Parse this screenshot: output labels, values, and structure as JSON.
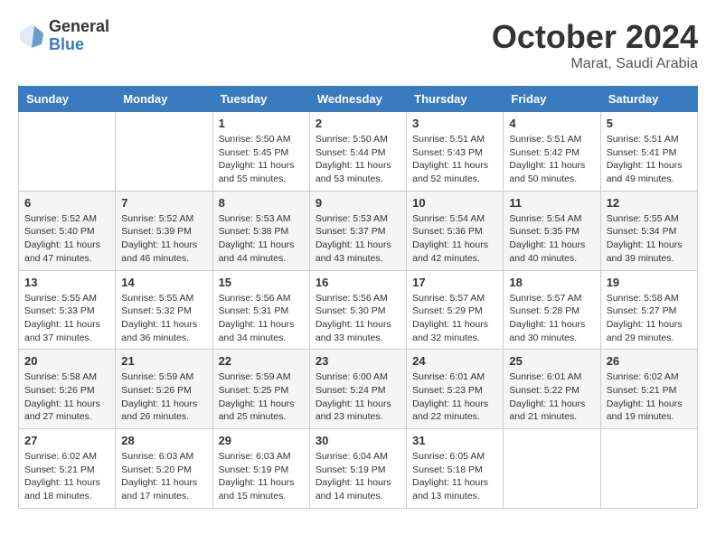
{
  "header": {
    "logo_general": "General",
    "logo_blue": "Blue",
    "month_title": "October 2024",
    "location": "Marat, Saudi Arabia"
  },
  "weekdays": [
    "Sunday",
    "Monday",
    "Tuesday",
    "Wednesday",
    "Thursday",
    "Friday",
    "Saturday"
  ],
  "weeks": [
    [
      {
        "day": "",
        "info": ""
      },
      {
        "day": "",
        "info": ""
      },
      {
        "day": "1",
        "info": "Sunrise: 5:50 AM\nSunset: 5:45 PM\nDaylight: 11 hours and 55 minutes."
      },
      {
        "day": "2",
        "info": "Sunrise: 5:50 AM\nSunset: 5:44 PM\nDaylight: 11 hours and 53 minutes."
      },
      {
        "day": "3",
        "info": "Sunrise: 5:51 AM\nSunset: 5:43 PM\nDaylight: 11 hours and 52 minutes."
      },
      {
        "day": "4",
        "info": "Sunrise: 5:51 AM\nSunset: 5:42 PM\nDaylight: 11 hours and 50 minutes."
      },
      {
        "day": "5",
        "info": "Sunrise: 5:51 AM\nSunset: 5:41 PM\nDaylight: 11 hours and 49 minutes."
      }
    ],
    [
      {
        "day": "6",
        "info": "Sunrise: 5:52 AM\nSunset: 5:40 PM\nDaylight: 11 hours and 47 minutes."
      },
      {
        "day": "7",
        "info": "Sunrise: 5:52 AM\nSunset: 5:39 PM\nDaylight: 11 hours and 46 minutes."
      },
      {
        "day": "8",
        "info": "Sunrise: 5:53 AM\nSunset: 5:38 PM\nDaylight: 11 hours and 44 minutes."
      },
      {
        "day": "9",
        "info": "Sunrise: 5:53 AM\nSunset: 5:37 PM\nDaylight: 11 hours and 43 minutes."
      },
      {
        "day": "10",
        "info": "Sunrise: 5:54 AM\nSunset: 5:36 PM\nDaylight: 11 hours and 42 minutes."
      },
      {
        "day": "11",
        "info": "Sunrise: 5:54 AM\nSunset: 5:35 PM\nDaylight: 11 hours and 40 minutes."
      },
      {
        "day": "12",
        "info": "Sunrise: 5:55 AM\nSunset: 5:34 PM\nDaylight: 11 hours and 39 minutes."
      }
    ],
    [
      {
        "day": "13",
        "info": "Sunrise: 5:55 AM\nSunset: 5:33 PM\nDaylight: 11 hours and 37 minutes."
      },
      {
        "day": "14",
        "info": "Sunrise: 5:55 AM\nSunset: 5:32 PM\nDaylight: 11 hours and 36 minutes."
      },
      {
        "day": "15",
        "info": "Sunrise: 5:56 AM\nSunset: 5:31 PM\nDaylight: 11 hours and 34 minutes."
      },
      {
        "day": "16",
        "info": "Sunrise: 5:56 AM\nSunset: 5:30 PM\nDaylight: 11 hours and 33 minutes."
      },
      {
        "day": "17",
        "info": "Sunrise: 5:57 AM\nSunset: 5:29 PM\nDaylight: 11 hours and 32 minutes."
      },
      {
        "day": "18",
        "info": "Sunrise: 5:57 AM\nSunset: 5:28 PM\nDaylight: 11 hours and 30 minutes."
      },
      {
        "day": "19",
        "info": "Sunrise: 5:58 AM\nSunset: 5:27 PM\nDaylight: 11 hours and 29 minutes."
      }
    ],
    [
      {
        "day": "20",
        "info": "Sunrise: 5:58 AM\nSunset: 5:26 PM\nDaylight: 11 hours and 27 minutes."
      },
      {
        "day": "21",
        "info": "Sunrise: 5:59 AM\nSunset: 5:26 PM\nDaylight: 11 hours and 26 minutes."
      },
      {
        "day": "22",
        "info": "Sunrise: 5:59 AM\nSunset: 5:25 PM\nDaylight: 11 hours and 25 minutes."
      },
      {
        "day": "23",
        "info": "Sunrise: 6:00 AM\nSunset: 5:24 PM\nDaylight: 11 hours and 23 minutes."
      },
      {
        "day": "24",
        "info": "Sunrise: 6:01 AM\nSunset: 5:23 PM\nDaylight: 11 hours and 22 minutes."
      },
      {
        "day": "25",
        "info": "Sunrise: 6:01 AM\nSunset: 5:22 PM\nDaylight: 11 hours and 21 minutes."
      },
      {
        "day": "26",
        "info": "Sunrise: 6:02 AM\nSunset: 5:21 PM\nDaylight: 11 hours and 19 minutes."
      }
    ],
    [
      {
        "day": "27",
        "info": "Sunrise: 6:02 AM\nSunset: 5:21 PM\nDaylight: 11 hours and 18 minutes."
      },
      {
        "day": "28",
        "info": "Sunrise: 6:03 AM\nSunset: 5:20 PM\nDaylight: 11 hours and 17 minutes."
      },
      {
        "day": "29",
        "info": "Sunrise: 6:03 AM\nSunset: 5:19 PM\nDaylight: 11 hours and 15 minutes."
      },
      {
        "day": "30",
        "info": "Sunrise: 6:04 AM\nSunset: 5:19 PM\nDaylight: 11 hours and 14 minutes."
      },
      {
        "day": "31",
        "info": "Sunrise: 6:05 AM\nSunset: 5:18 PM\nDaylight: 11 hours and 13 minutes."
      },
      {
        "day": "",
        "info": ""
      },
      {
        "day": "",
        "info": ""
      }
    ]
  ]
}
